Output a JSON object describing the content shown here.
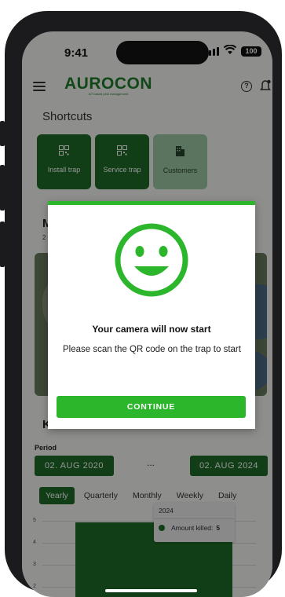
{
  "status_bar": {
    "time": "9:41",
    "battery": "100"
  },
  "app_bar": {
    "logo": "AUROCON",
    "logo_tagline": "IoT based pest management"
  },
  "shortcuts": {
    "title": "Shortcuts",
    "tiles": [
      {
        "label": "Install trap",
        "icon": "qr-code-icon"
      },
      {
        "label": "Service trap",
        "icon": "qr-code-icon"
      },
      {
        "label": "Customers",
        "icon": "building-icon"
      }
    ]
  },
  "map_section": {
    "title_visible": "M",
    "subtitle_visible": "2"
  },
  "kills": {
    "title_visible": "Ki",
    "period_label": "Period",
    "start_date": "02. AUG 2020",
    "separator": "...",
    "end_date": "02. AUG 2024",
    "tabs": [
      {
        "label": "Yearly",
        "active": true
      },
      {
        "label": "Quarterly",
        "active": false
      },
      {
        "label": "Monthly",
        "active": false
      },
      {
        "label": "Weekly",
        "active": false
      },
      {
        "label": "Daily",
        "active": false
      }
    ]
  },
  "chart_data": {
    "type": "bar",
    "categories": [
      "2024"
    ],
    "series": [
      {
        "name": "Amount killed",
        "values": [
          5
        ]
      }
    ],
    "y_ticks": [
      "5",
      "4",
      "3",
      "2"
    ],
    "tooltip": {
      "title": "2024",
      "label": "Amount killed:",
      "value": "5"
    },
    "color": "#1e6b28"
  },
  "dialog": {
    "icon": "smiley-icon",
    "title": "Your camera will now start",
    "message": "Please scan the QR code on the trap to start",
    "button": "CONTINUE",
    "accent": "#2cb62c"
  }
}
